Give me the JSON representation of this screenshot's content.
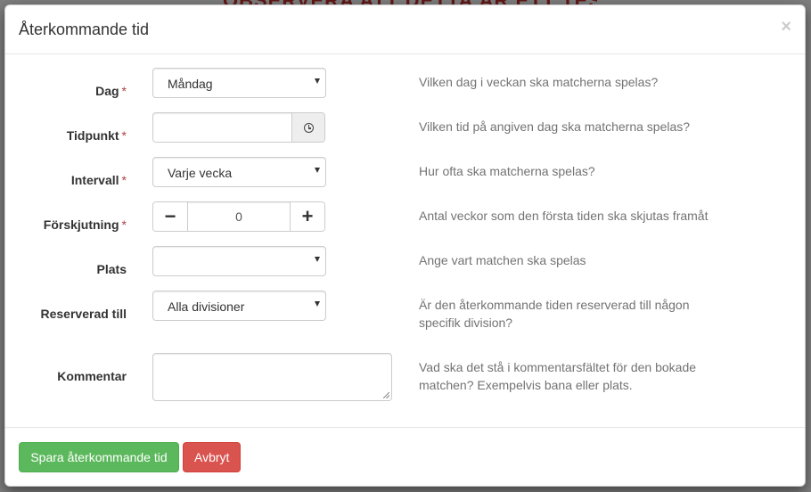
{
  "background": {
    "banner": "OBSERVERA ATT DETTA ÄR ETT TESTSYSTEM"
  },
  "modal": {
    "title": "Återkommande tid",
    "close_glyph": "×"
  },
  "required_marker": "*",
  "fields": {
    "dag": {
      "label": "Dag",
      "value": "Måndag",
      "help": "Vilken dag i veckan ska matcherna spelas?"
    },
    "tidpunkt": {
      "label": "Tidpunkt",
      "value": "",
      "help": "Vilken tid på angiven dag ska matcherna spelas?"
    },
    "intervall": {
      "label": "Intervall",
      "value": "Varje vecka",
      "help": "Hur ofta ska matcherna spelas?"
    },
    "forskjutning": {
      "label": "Förskjutning",
      "value": "0",
      "minus": "−",
      "plus": "+",
      "help": "Antal veckor som den första tiden ska skjutas framåt"
    },
    "plats": {
      "label": "Plats",
      "value": "",
      "help": "Ange vart matchen ska spelas"
    },
    "reserverad": {
      "label": "Reserverad till",
      "value": "Alla divisioner",
      "help": "Är den återkommande tiden reserverad till någon specifik division?"
    },
    "kommentar": {
      "label": "Kommentar",
      "value": "",
      "help": "Vad ska det stå i kommentarsfältet för den bokade matchen? Exempelvis bana eller plats."
    }
  },
  "footer": {
    "save_label": "Spara återkommande tid",
    "cancel_label": "Avbryt"
  },
  "colors": {
    "success": "#5cb85c",
    "danger": "#d9534f",
    "required": "#a94442"
  },
  "icons": {
    "time_addon": "clock-icon",
    "select_caret": "caret-down-icon"
  }
}
